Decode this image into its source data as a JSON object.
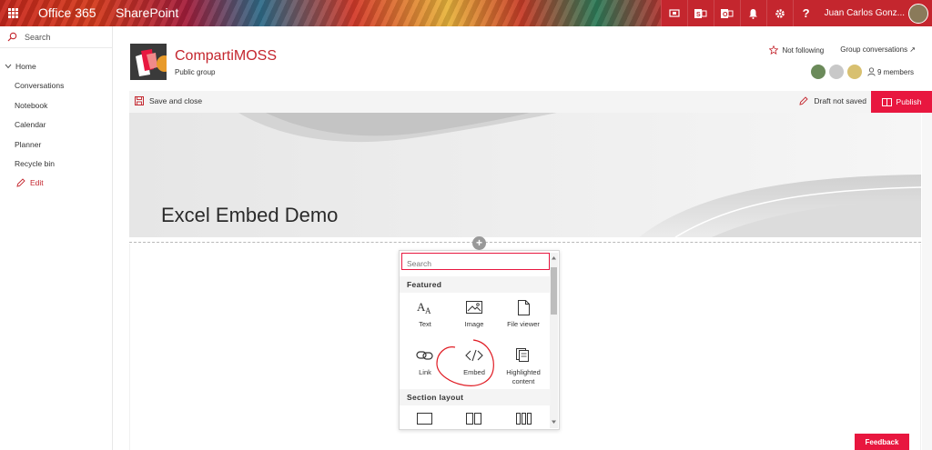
{
  "suitebar": {
    "office_label": "Office 365",
    "app_label": "SharePoint",
    "user_name": "Juan Carlos Gonz...",
    "icons": [
      "screen-icon",
      "outlook-icon",
      "sway-icon",
      "bell-icon",
      "gear-icon",
      "help-icon"
    ]
  },
  "leftnav": {
    "search_placeholder": "Search",
    "items": [
      {
        "label": "Home"
      },
      {
        "label": "Conversations"
      },
      {
        "label": "Notebook"
      },
      {
        "label": "Calendar"
      },
      {
        "label": "Planner"
      },
      {
        "label": "Recycle bin"
      }
    ],
    "edit_label": "Edit"
  },
  "site": {
    "title": "CompartiMOSS",
    "subtitle": "Public group",
    "follow_label": "Not following",
    "group_conversations_label": "Group conversations ↗",
    "members_label": "9 members"
  },
  "commandbar": {
    "save_label": "Save and close",
    "draft_label": "Draft not saved",
    "publish_label": "Publish"
  },
  "page": {
    "title": "Excel Embed Demo"
  },
  "toolbox": {
    "search_placeholder": "Search",
    "featured_heading": "Featured",
    "items": [
      {
        "label": "Text",
        "icon": "text-icon"
      },
      {
        "label": "Image",
        "icon": "image-icon"
      },
      {
        "label": "File viewer",
        "icon": "file-icon"
      },
      {
        "label": "Link",
        "icon": "link-icon"
      },
      {
        "label": "Embed",
        "icon": "embed-icon"
      },
      {
        "label": "Highlighted content",
        "icon": "highlighted-content-icon"
      }
    ],
    "section_heading": "Section layout"
  },
  "feedback_label": "Feedback",
  "colors": {
    "accent": "#e8173f",
    "site_title": "#c4262e",
    "annotation": "#e01c24"
  }
}
